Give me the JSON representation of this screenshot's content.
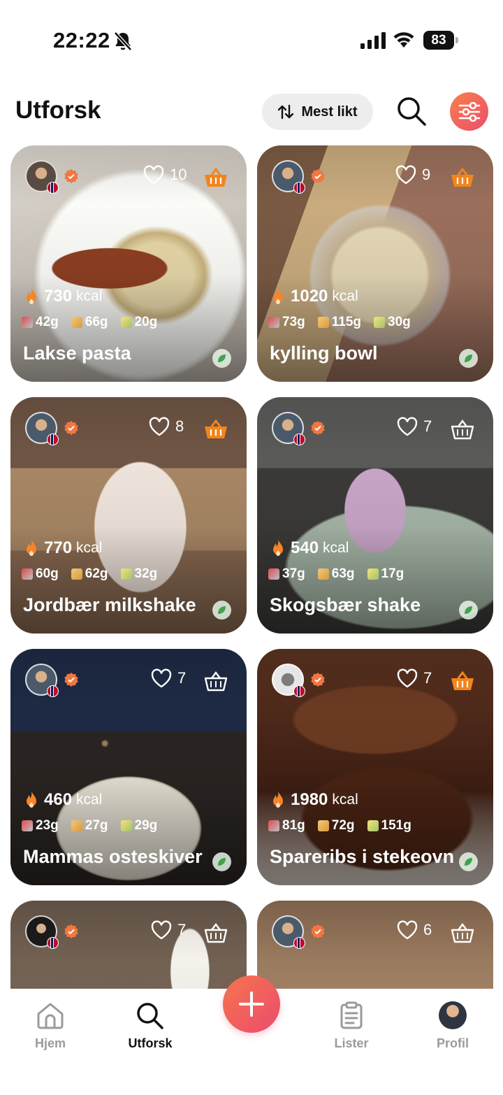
{
  "status_bar": {
    "time": "22:22",
    "battery": "83"
  },
  "header": {
    "title": "Utforsk",
    "sort_label": "Mest likt"
  },
  "cards": [
    {
      "likes": "10",
      "kcal": "730",
      "kcal_unit": "kcal",
      "protein": "42g",
      "carbs": "66g",
      "fat": "20g",
      "name": "Lakse pasta",
      "basket_active": true
    },
    {
      "likes": "9",
      "kcal": "1020",
      "kcal_unit": "kcal",
      "protein": "73g",
      "carbs": "115g",
      "fat": "30g",
      "name": "kylling bowl",
      "basket_active": true
    },
    {
      "likes": "8",
      "kcal": "770",
      "kcal_unit": "kcal",
      "protein": "60g",
      "carbs": "62g",
      "fat": "32g",
      "name": "Jordbær milkshake",
      "basket_active": true
    },
    {
      "likes": "7",
      "kcal": "540",
      "kcal_unit": "kcal",
      "protein": "37g",
      "carbs": "63g",
      "fat": "17g",
      "name": "Skogsbær shake",
      "basket_active": false
    },
    {
      "likes": "7",
      "kcal": "460",
      "kcal_unit": "kcal",
      "protein": "23g",
      "carbs": "27g",
      "fat": "29g",
      "name": "Mammas osteskiver",
      "basket_active": false
    },
    {
      "likes": "7",
      "kcal": "1980",
      "kcal_unit": "kcal",
      "protein": "81g",
      "carbs": "72g",
      "fat": "151g",
      "name": "Spareribs i stekeovn",
      "basket_active": true
    },
    {
      "likes": "7",
      "basket_active": false
    },
    {
      "likes": "6",
      "basket_active": false
    }
  ],
  "tabs": [
    {
      "label": "Hjem",
      "icon": "home-icon"
    },
    {
      "label": "Utforsk",
      "icon": "search-icon",
      "active": true
    },
    {
      "label": "Lister",
      "icon": "clipboard-icon"
    },
    {
      "label": "Profil",
      "icon": "avatar"
    }
  ],
  "colors": {
    "accent": "#f16a57",
    "basket_orange": "#f2851c",
    "inactive_tab": "#9a9a9a"
  }
}
